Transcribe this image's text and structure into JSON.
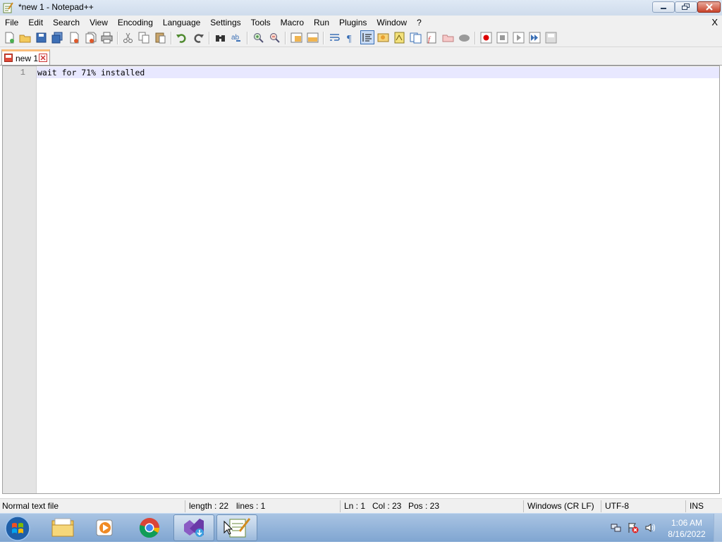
{
  "window": {
    "title": "*new 1 - Notepad++"
  },
  "menu": {
    "items": [
      "File",
      "Edit",
      "Search",
      "View",
      "Encoding",
      "Language",
      "Settings",
      "Tools",
      "Macro",
      "Run",
      "Plugins",
      "Window",
      "?"
    ],
    "close_label": "X"
  },
  "toolbar": {
    "icons": [
      "new-file-icon",
      "open-file-icon",
      "save-icon",
      "save-all-icon",
      "close-icon",
      "close-all-icon",
      "print-icon",
      "cut-icon",
      "copy-icon",
      "paste-icon",
      "undo-icon",
      "redo-icon",
      "find-icon",
      "replace-icon",
      "zoom-in-icon",
      "zoom-out-icon",
      "sync-vertical-icon",
      "sync-horizontal-icon",
      "word-wrap-icon",
      "show-all-characters-icon",
      "indent-guide-icon",
      "user-language-icon",
      "document-map-icon",
      "document-list-icon",
      "function-list-icon",
      "folder-as-workspace-icon",
      "monitoring-icon",
      "macro-record-icon",
      "macro-stop-icon",
      "macro-play-icon",
      "macro-run-multiple-icon",
      "macro-save-icon"
    ]
  },
  "tabs": [
    {
      "label": "new 1",
      "modified": true
    }
  ],
  "editor": {
    "lines": [
      {
        "number": "1",
        "text": "wait for 71% installed"
      }
    ]
  },
  "status": {
    "file_type": "Normal text file",
    "length": "length : 22",
    "lines": "lines : 1",
    "ln": "Ln : 1",
    "col": "Col : 23",
    "pos": "Pos : 23",
    "eol": "Windows (CR LF)",
    "encoding": "UTF-8",
    "mode": "INS"
  },
  "taskbar": {
    "apps": [
      "windows-explorer-icon",
      "media-player-icon",
      "chrome-icon",
      "visual-studio-installer-icon",
      "notepad-plus-plus-icon"
    ],
    "clock_time": "1:06 AM",
    "clock_date": "8/16/2022"
  },
  "colors": {
    "current_line": "#e8e8ff",
    "gutter": "#e4e4e4",
    "tab_accent": "#fabd7a"
  }
}
